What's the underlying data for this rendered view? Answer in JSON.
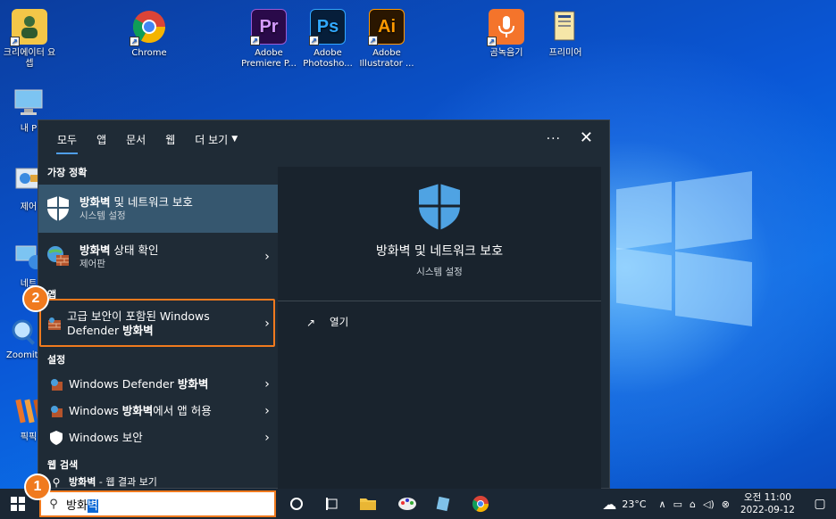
{
  "desktop": {
    "icons": [
      {
        "label": "크리에이터 요셉",
        "glyph": "",
        "bg": "#f3c648"
      },
      {
        "label": "Chrome",
        "glyph": "",
        "bg": "none"
      },
      {
        "label": "Adobe Premiere P...",
        "glyph": "Pr",
        "bg": "#2a0a4a",
        "fg": "#d59cff"
      },
      {
        "label": "Adobe Photosho...",
        "glyph": "Ps",
        "bg": "#061e3a",
        "fg": "#31a8ff"
      },
      {
        "label": "Adobe Illustrator ...",
        "glyph": "Ai",
        "bg": "#2a1600",
        "fg": "#ff9a00"
      },
      {
        "label": "곰녹음기",
        "glyph": "",
        "bg": "#f4742b"
      },
      {
        "label": "프리미어",
        "glyph": "",
        "bg": "none"
      }
    ],
    "left_icons": [
      {
        "label": "내 P"
      },
      {
        "label": "제어"
      },
      {
        "label": "네트"
      },
      {
        "label": "Zoomit6"
      },
      {
        "label": "픽픽"
      }
    ]
  },
  "flyout": {
    "tabs": [
      {
        "label": "모두",
        "active": true
      },
      {
        "label": "앱"
      },
      {
        "label": "문서"
      },
      {
        "label": "웹"
      },
      {
        "label": "더 보기"
      }
    ],
    "more_label": "···",
    "close_label": "✕",
    "sections": {
      "best": "가장 정확",
      "apps": "앱",
      "settings": "설정",
      "web": "웹 검색"
    },
    "best_match": {
      "title_bold": "방화벽",
      "title_rest": " 및 네트워크 보호",
      "subtitle": "시스템 설정"
    },
    "status": {
      "title_bold": "방화벽",
      "title_rest": " 상태 확인",
      "subtitle": "제어판"
    },
    "app_result": {
      "line1": "고급 보안이 포함된 Windows",
      "line2_pre": "Defender ",
      "line2_bold": "방화벽"
    },
    "settings_results": [
      {
        "pre": "Windows Defender ",
        "bold": "방화벽",
        "post": ""
      },
      {
        "pre": "Windows ",
        "bold": "방화벽",
        "post": "에서 앱 허용"
      },
      {
        "pre": "Windows 보안",
        "bold": "",
        "post": ""
      }
    ],
    "web_result": {
      "bold": "방화벽",
      "rest": " - 웹 결과 보기"
    },
    "preview": {
      "title": "방화벽 및 네트워크 보호",
      "subtitle": "시스템 설정",
      "open_label": "열기"
    }
  },
  "steps": [
    "1",
    "2"
  ],
  "taskbar": {
    "search_query_typed": "방화",
    "search_query_selected": "벽",
    "weather": "23°C",
    "time": "오전 11:00",
    "date": "2022-09-12"
  },
  "colors": {
    "accent": "#f07a1e",
    "selection": "#36576f",
    "flyout_bg": "#1f2b36"
  }
}
